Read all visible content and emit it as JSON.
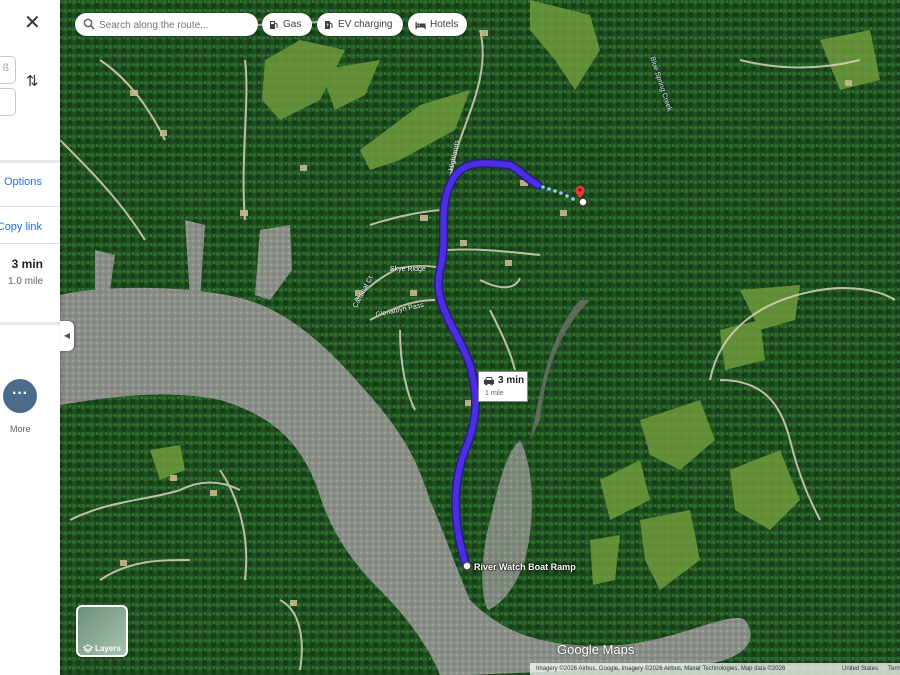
{
  "search": {
    "placeholder": "Search along the route..."
  },
  "chips": [
    {
      "label": "Gas",
      "icon": "gas-station-icon"
    },
    {
      "label": "EV charging",
      "icon": "ev-charging-icon"
    },
    {
      "label": "Hotels",
      "icon": "hotel-icon"
    }
  ],
  "panel": {
    "close_icon": "close-icon",
    "swap_icon": "swap-icon",
    "options_label": "Options",
    "copy_link_label": "Copy link",
    "route_time": "3 min",
    "route_distance": "1.0 mile",
    "more_label": "More"
  },
  "map": {
    "route_bubble": {
      "time": "3 min",
      "distance": "1 mile"
    },
    "destination_label": "River Watch Boat Ramp",
    "road_labels": [
      "Highlands",
      "Skye Ridge",
      "Cardinal Ct",
      "Glenalbyn Pass"
    ],
    "creek_label": "Blue Spring Creek",
    "route_color": "#4a2ee0",
    "marker_color": "#e53935"
  },
  "layers_label": "Layers",
  "logo": "Google Maps",
  "attribution": "Imagery ©2026 Airbus, Google, Imagery ©2026 Airbus, Maxar Technologies, Map data ©2026",
  "united_states": "United States",
  "terms": "Terms"
}
